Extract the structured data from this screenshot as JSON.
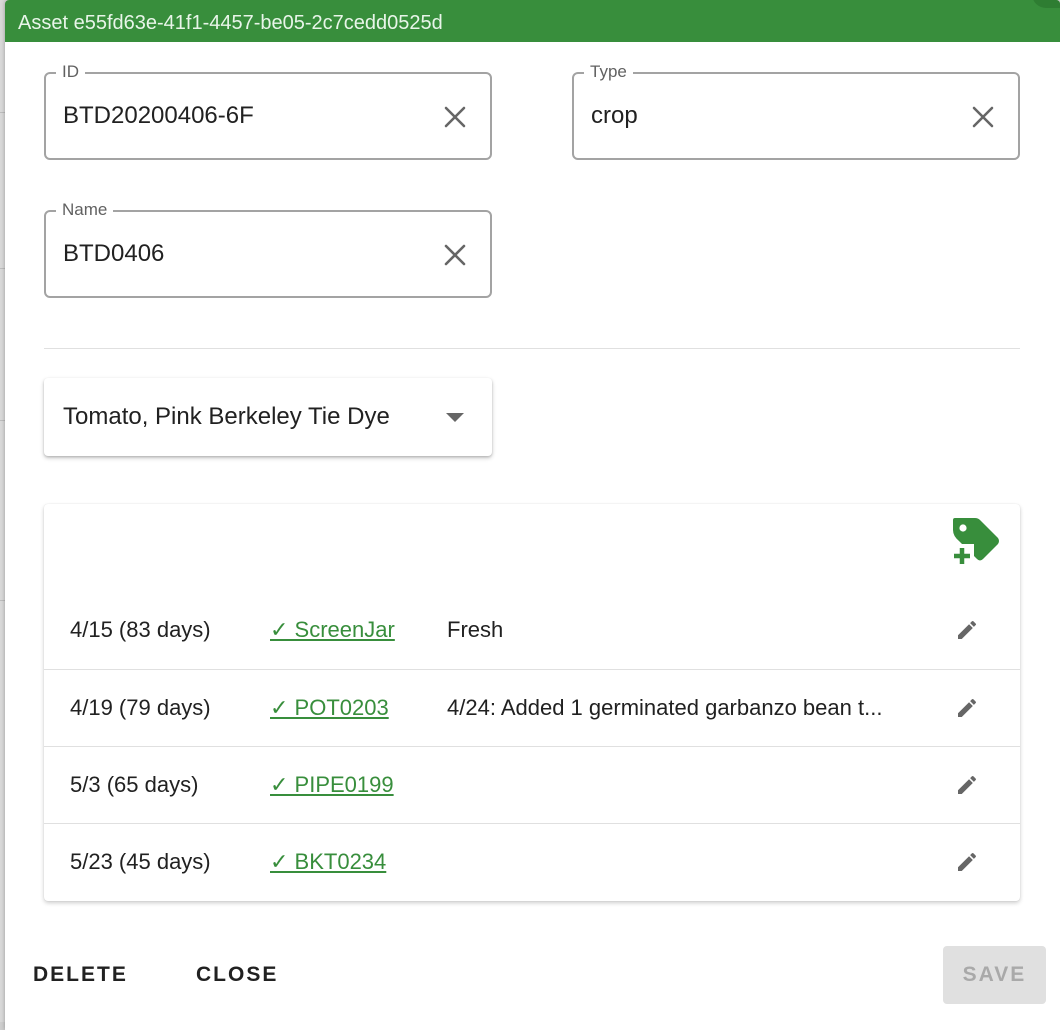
{
  "dialog": {
    "title": "Asset e55fd63e-41f1-4457-be05-2c7cedd0525d"
  },
  "fields": {
    "id": {
      "label": "ID",
      "value": "BTD20200406-6F"
    },
    "type": {
      "label": "Type",
      "value": "crop"
    },
    "name": {
      "label": "Name",
      "value": "BTD0406"
    }
  },
  "variety_select": {
    "selected": "Tomato, Pink Berkeley Tie Dye"
  },
  "locations": {
    "add_icon": "add-tag-icon",
    "rows": [
      {
        "date": "4/15 (83 days)",
        "location": "✓ ScreenJar",
        "note": "Fresh"
      },
      {
        "date": "4/19 (79 days)",
        "location": "✓ POT0203",
        "note": "4/24: Added 1 germinated garbanzo bean t..."
      },
      {
        "date": "5/3 (65 days)",
        "location": "✓ PIPE0199",
        "note": ""
      },
      {
        "date": "5/23 (45 days)",
        "location": "✓ BKT0234",
        "note": ""
      }
    ]
  },
  "actions": {
    "delete_label": "DELETE",
    "close_label": "CLOSE",
    "save_label": "SAVE"
  },
  "colors": {
    "accent": "#388e3c",
    "title_text": "#e8f5e9",
    "disabled_bg": "#e0e0e0"
  }
}
